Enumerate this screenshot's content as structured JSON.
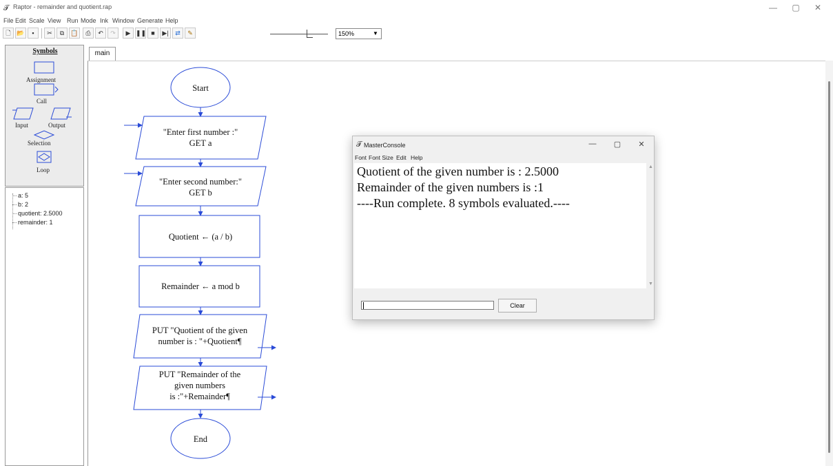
{
  "window": {
    "title": "Raptor - remainder and quotient.rap",
    "controls": {
      "minimize": "—",
      "maximize": "▢",
      "close": "✕"
    }
  },
  "menu": [
    "File",
    "Edit",
    "Scale",
    "View",
    "Run",
    "Mode",
    "Ink",
    "Window",
    "Generate",
    "Help"
  ],
  "toolbar": {
    "icons": [
      "new-icon",
      "open-icon",
      "save-icon",
      "cut-icon",
      "copy-icon",
      "paste-icon",
      "print-icon",
      "undo-icon",
      "redo-icon",
      "play-icon",
      "pause-icon",
      "stop-icon",
      "step-icon",
      "test-server-icon",
      "pen-icon"
    ],
    "zoom": "150%",
    "speed_level": 0.73
  },
  "symbols_panel": {
    "title": "Symbols",
    "items": [
      "Assignment",
      "Call",
      "Input",
      "Output",
      "Selection",
      "Loop"
    ]
  },
  "watch": [
    {
      "name": "a",
      "value": "5",
      "text": "a: 5"
    },
    {
      "name": "b",
      "value": "2",
      "text": "b: 2"
    },
    {
      "name": "quotient",
      "value": "2.5000",
      "text": "quotient: 2.5000"
    },
    {
      "name": "remainder",
      "value": "1",
      "text": "remainder: 1"
    }
  ],
  "tabs": [
    {
      "label": "main"
    }
  ],
  "flowchart": {
    "start": "Start",
    "input1": {
      "prompt": "\"Enter first number :\"",
      "get": "GET a"
    },
    "input2": {
      "prompt": "\"Enter second number:\"",
      "get": "GET b"
    },
    "assign1": "Quotient ← (a / b)",
    "assign2": "Remainder ← a mod b",
    "output1": {
      "line1": "PUT \"Quotient of the given",
      "line2": "number is : \"+Quotient¶"
    },
    "output2": {
      "line1": "PUT \"Remainder of the",
      "line2": "given numbers",
      "line3": "is :\"+Remainder¶"
    },
    "end": "End"
  },
  "console": {
    "title": "MasterConsole",
    "menu": [
      "Font",
      "Font Size",
      "Edit",
      "Help"
    ],
    "lines": [
      "Quotient of the given number is : 2.5000",
      "Remainder of the given numbers is :1",
      "----Run complete.  8 symbols evaluated.----"
    ],
    "input_value": "",
    "clear_label": "Clear"
  }
}
